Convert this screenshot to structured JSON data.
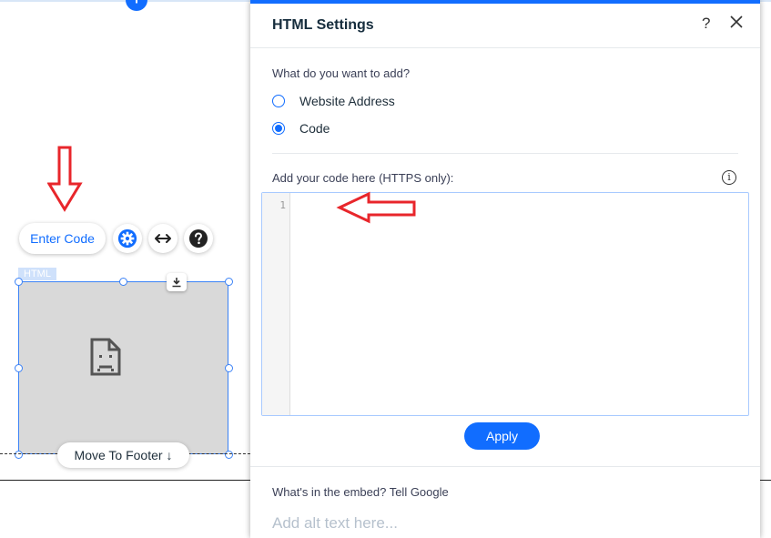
{
  "editor": {
    "enter_code_label": "Enter Code",
    "element_tag": "HTML",
    "move_footer_label": "Move To Footer ↓",
    "add_section_symbol": "+"
  },
  "panel": {
    "title": "HTML Settings",
    "help_symbol": "?",
    "question": "What do you want to add?",
    "options": [
      {
        "label": "Website Address",
        "selected": false
      },
      {
        "label": "Code",
        "selected": true
      }
    ],
    "code_label": "Add your code here (HTTPS only):",
    "info_symbol": "i",
    "line_number": "1",
    "apply_label": "Apply",
    "embed_label": "What's in the embed? Tell Google",
    "alt_placeholder": "Add alt text here..."
  },
  "colors": {
    "accent": "#116dff",
    "annotation_arrow": "#e8262b"
  }
}
